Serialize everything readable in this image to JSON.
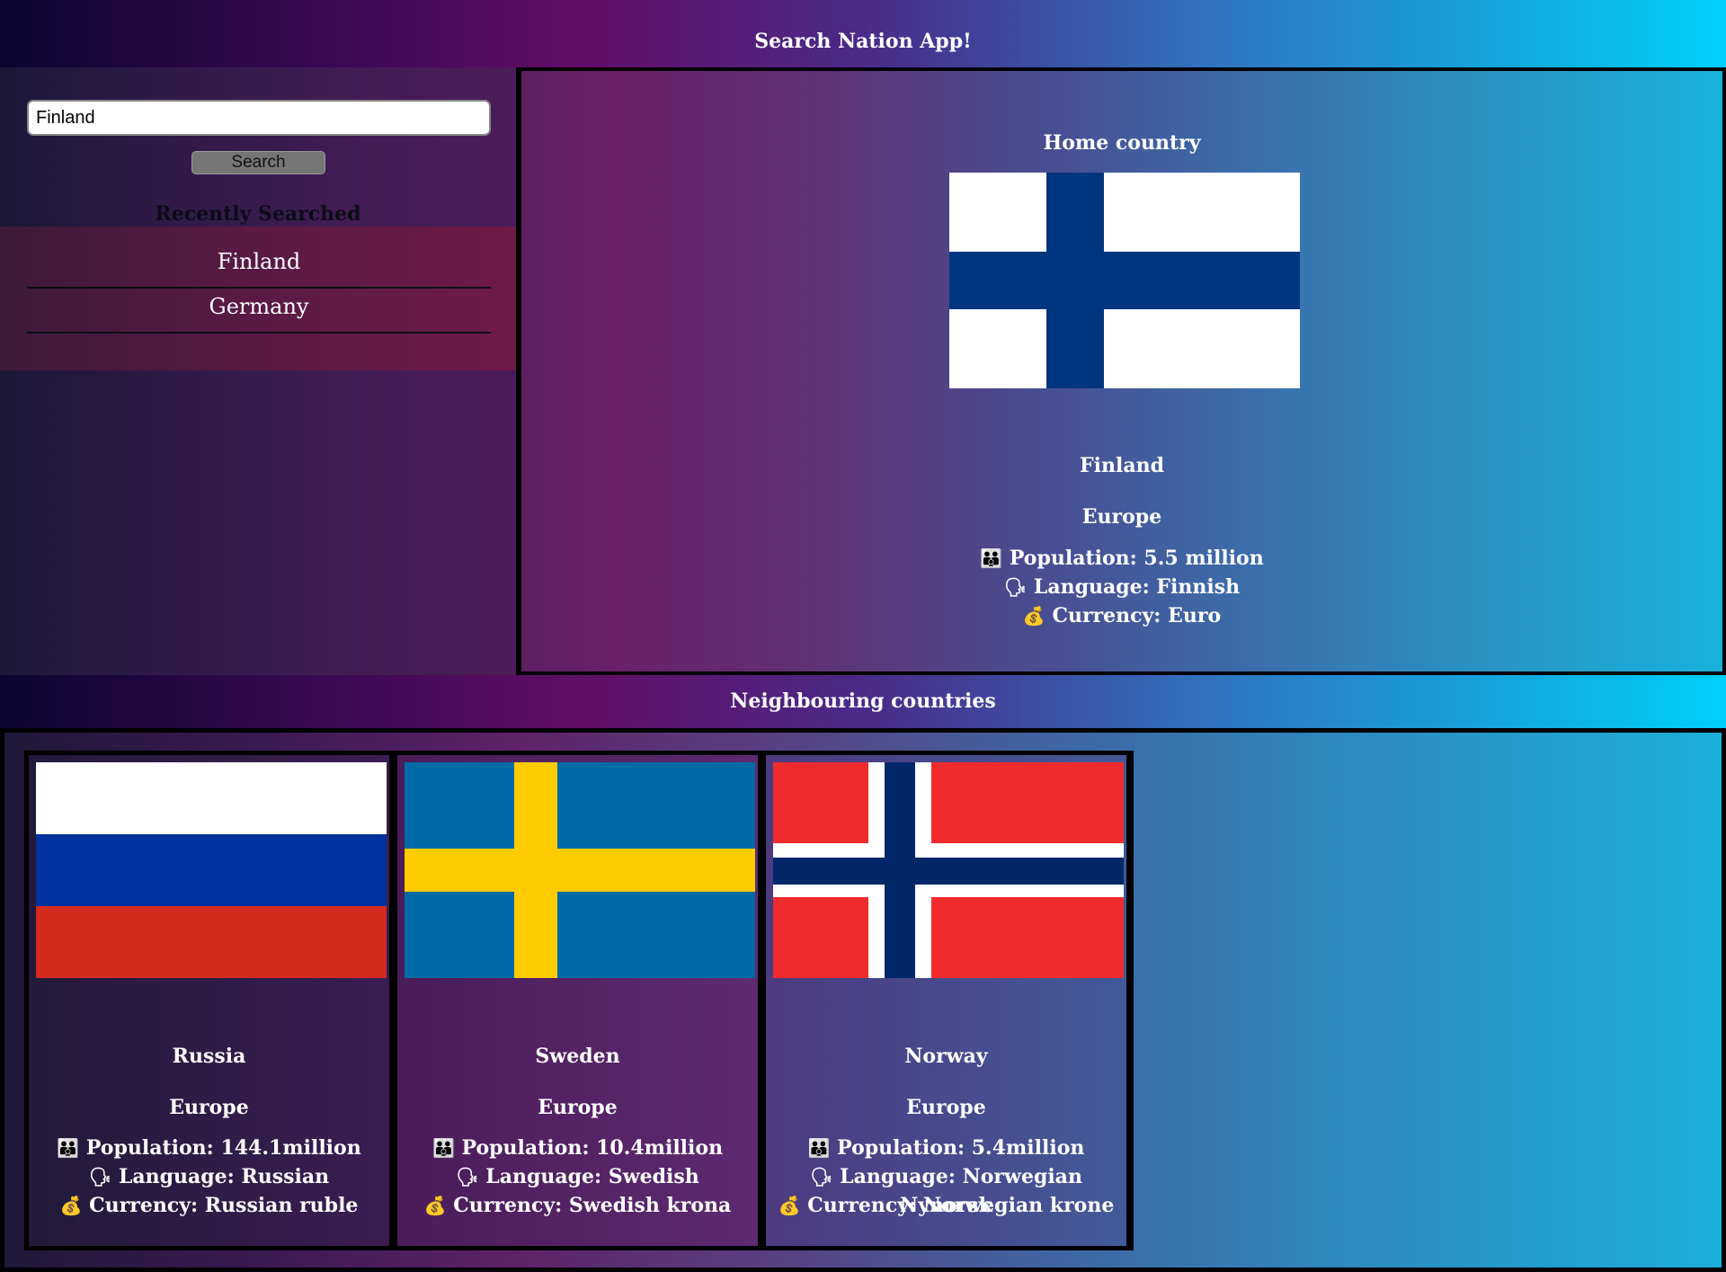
{
  "app": {
    "title": "Search Nation App!"
  },
  "search": {
    "value": "Finland",
    "button_label": "Search"
  },
  "recent": {
    "title": "Recently Searched",
    "items": [
      "Finland",
      "Germany"
    ]
  },
  "home": {
    "title": "Home country",
    "name": "Finland",
    "region": "Europe",
    "population": "Population: 5.5 million",
    "language": "Language: Finnish",
    "currency": "Currency: Euro"
  },
  "neighbours": {
    "title": "Neighbouring countries",
    "items": [
      {
        "name": "Russia",
        "region": "Europe",
        "population": "Population: 144.1million",
        "language": "Language: Russian",
        "currency": "Currency: Russian ruble"
      },
      {
        "name": "Sweden",
        "region": "Europe",
        "population": "Population: 10.4million",
        "language": "Language: Swedish",
        "currency": "Currency: Swedish krona"
      },
      {
        "name": "Norway",
        "region": "Europe",
        "population": "Population: 5.4million",
        "language": "Language: Norwegian Nynorsk",
        "currency": "Currency: Norwegian krone"
      }
    ]
  },
  "icons": {
    "population": "people-icon",
    "language": "speaking-head-icon",
    "currency": "money-bag-icon"
  },
  "colors": {
    "finland_blue": "#003580",
    "russia_blue": "#0032a0",
    "russia_red": "#d52b1e",
    "sweden_blue": "#006aa7",
    "sweden_yellow": "#fecc00",
    "norway_red": "#ef2b2d",
    "norway_blue": "#002868"
  }
}
